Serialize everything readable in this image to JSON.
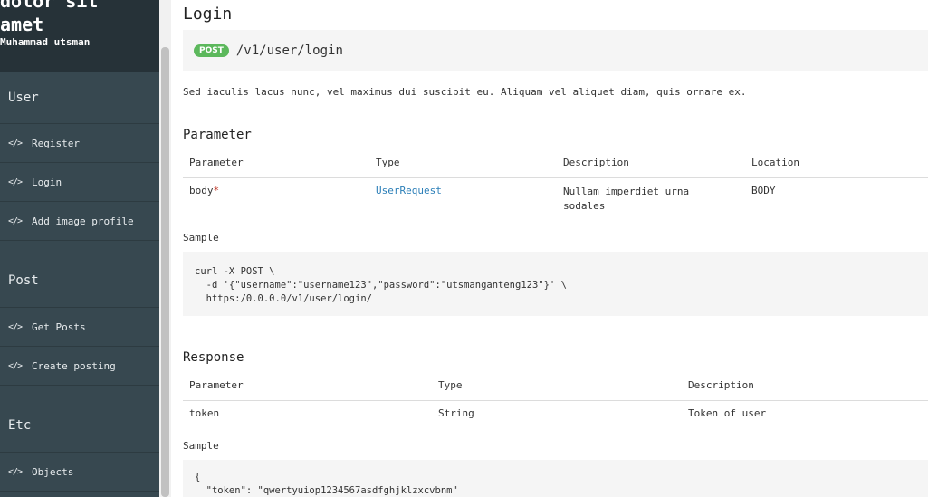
{
  "sidebar": {
    "brand_title": "dolor sit\namet",
    "brand_author": "Muhammad utsman",
    "sections": [
      {
        "title": "User",
        "items": [
          "Register",
          "Login",
          "Add image profile"
        ]
      },
      {
        "title": "Post",
        "items": [
          "Get Posts",
          "Create posting"
        ]
      },
      {
        "title": "Etc",
        "items": [
          "Objects"
        ]
      }
    ],
    "code_icon": "</>"
  },
  "main": {
    "title": "Login",
    "method": "POST",
    "path": "/v1/user/login",
    "description": "Sed iaculis lacus nunc, vel maximus dui suscipit eu. Aliquam vel aliquet diam, quis ornare ex.",
    "parameter": {
      "heading": "Parameter",
      "headers": [
        "Parameter",
        "Type",
        "Description",
        "Location"
      ],
      "row": {
        "name": "body",
        "required": "*",
        "type": "UserRequest",
        "description": "Nullam imperdiet urna sodales",
        "location": "BODY"
      },
      "sample_label": "Sample",
      "sample_code": "curl -X POST \\\n  -d '{\"username\":\"username123\",\"password\":\"utsmanganteng123\"}' \\\n  https:/0.0.0.0/v1/user/login/"
    },
    "response": {
      "heading": "Response",
      "headers": [
        "Parameter",
        "Type",
        "Description"
      ],
      "row": {
        "name": "token",
        "type": "String",
        "description": "Token of user"
      },
      "sample_label": "Sample",
      "sample_code": "{\n  \"token\": \"qwertyuiop1234567asdfghjklzxcvbnm\""
    }
  },
  "colors": {
    "sidebar_bg": "#374850",
    "header_bg": "#263238",
    "badge_green": "#5cb85c",
    "link_blue": "#2c7fb8"
  }
}
